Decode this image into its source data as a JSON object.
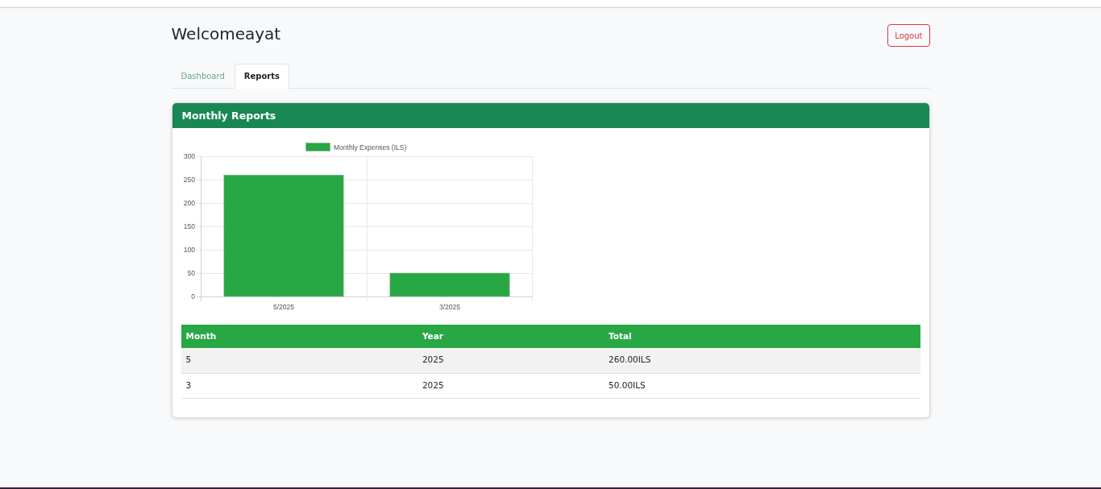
{
  "header": {
    "title": "Welcomeayat",
    "logout_button": "Logout"
  },
  "tabs": [
    {
      "label": "Dashboard",
      "selected": false
    },
    {
      "label": "Reports",
      "selected": true
    }
  ],
  "card": {
    "title": "Monthly Reports",
    "chart_data": {
      "type": "bar",
      "categories": [
        "5/2025",
        "3/2025"
      ],
      "series": [
        {
          "name": "Monthly Expenses (ILS)",
          "color": "#28a745",
          "values": [
            260,
            50
          ]
        }
      ],
      "ylim": [
        0,
        300
      ],
      "yticks": [
        0,
        50,
        100,
        150,
        200,
        250,
        300
      ],
      "grid": true
    },
    "table": {
      "columns": [
        "Month",
        "Year",
        "Total"
      ],
      "rows": [
        [
          "5",
          "2025",
          "260.00ILS"
        ],
        [
          "3",
          "2025",
          "50.00ILS"
        ]
      ]
    }
  }
}
